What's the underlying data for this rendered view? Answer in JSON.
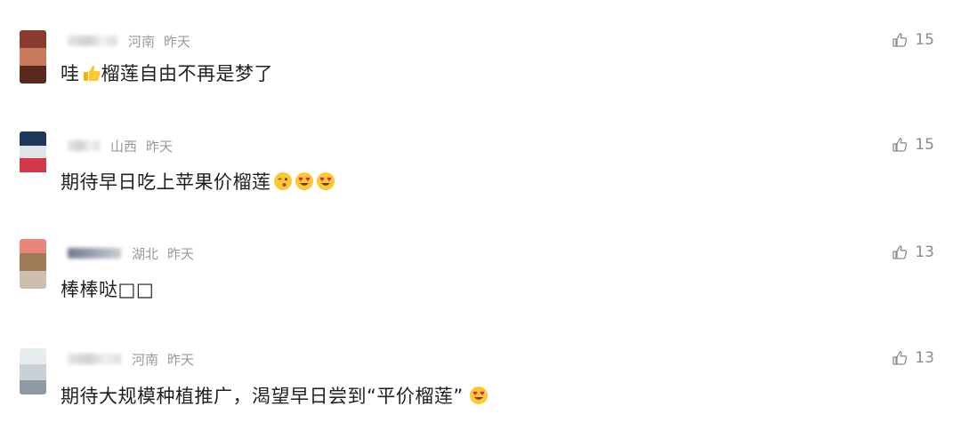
{
  "comments": [
    {
      "location": "河南",
      "time": "昨天",
      "text_before": "哇",
      "text_after": "榴莲自由不再是梦了",
      "emoji_inline": "thumbs-up",
      "likes": "15",
      "avatar_colors": [
        "#8a3a2e",
        "#c77b5b",
        "#5a2a1e"
      ]
    },
    {
      "location": "山西",
      "time": "昨天",
      "text": "期待早日吃上苹果价榴莲",
      "emojis": [
        "winking-face",
        "heart-eyes-face",
        "heart-eyes-face"
      ],
      "likes": "15",
      "avatar_colors": [
        "#1e3658",
        "#dfe3ea",
        "#d3384a"
      ]
    },
    {
      "location": "湖北",
      "time": "昨天",
      "text": "棒棒哒□□",
      "likes": "13",
      "avatar_colors": [
        "#e8867a",
        "#9f7b58",
        "#cdbfb0"
      ]
    },
    {
      "location": "河南",
      "time": "昨天",
      "text": "期待大规模种植推广，渴望早日尝到“平价榴莲”",
      "emojis": [
        "heart-eyes-face"
      ],
      "likes": "13",
      "avatar_colors": [
        "#e7ecee",
        "#c9d0d6",
        "#8f9aa5"
      ]
    }
  ],
  "colors": {
    "meta_text": "#9a9a9a",
    "comment_text": "#1f1f1f",
    "like_icon": "#8c8c8c"
  }
}
